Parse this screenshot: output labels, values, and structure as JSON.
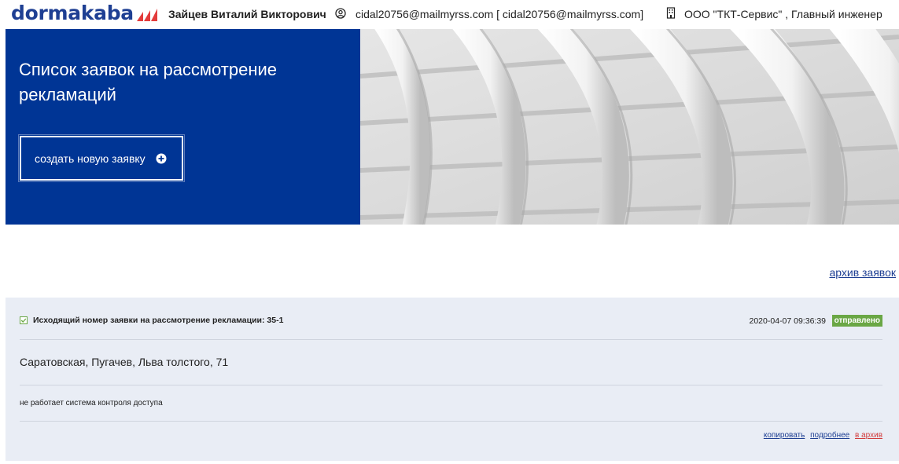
{
  "header": {
    "logo_text": "dormakaba",
    "user_name": "Зайцев Виталий Викторович",
    "user_email": "cidal20756@mailmyrss.com [ cidal20756@mailmyrss.com]",
    "organization": "ООО \"ТКТ-Сервис\" , Главный инженер",
    "icons": {
      "user": "user-circle-icon",
      "org": "building-icon"
    },
    "colors": {
      "brand": "#1e3f93",
      "logo_accent": "#e33b3b"
    }
  },
  "hero": {
    "title": "Список заявок на рассмотрение рекламаций",
    "create_button_label": "создать новую заявку",
    "background": "#003595"
  },
  "archive_link": "архив заявок",
  "requests": [
    {
      "title": "Исходящий номер заявки на рассмотрение рекламации: 35-1",
      "datetime": "2020-04-07 09:36:39",
      "status": "отправлено",
      "status_color": "#6aa745",
      "address": "Саратовская, Пугачев, Льва толстого, 71",
      "description": "не работает система контроля доступа",
      "actions": {
        "copy": "копировать",
        "details": "подробнее",
        "archive": "в архив"
      }
    }
  ]
}
